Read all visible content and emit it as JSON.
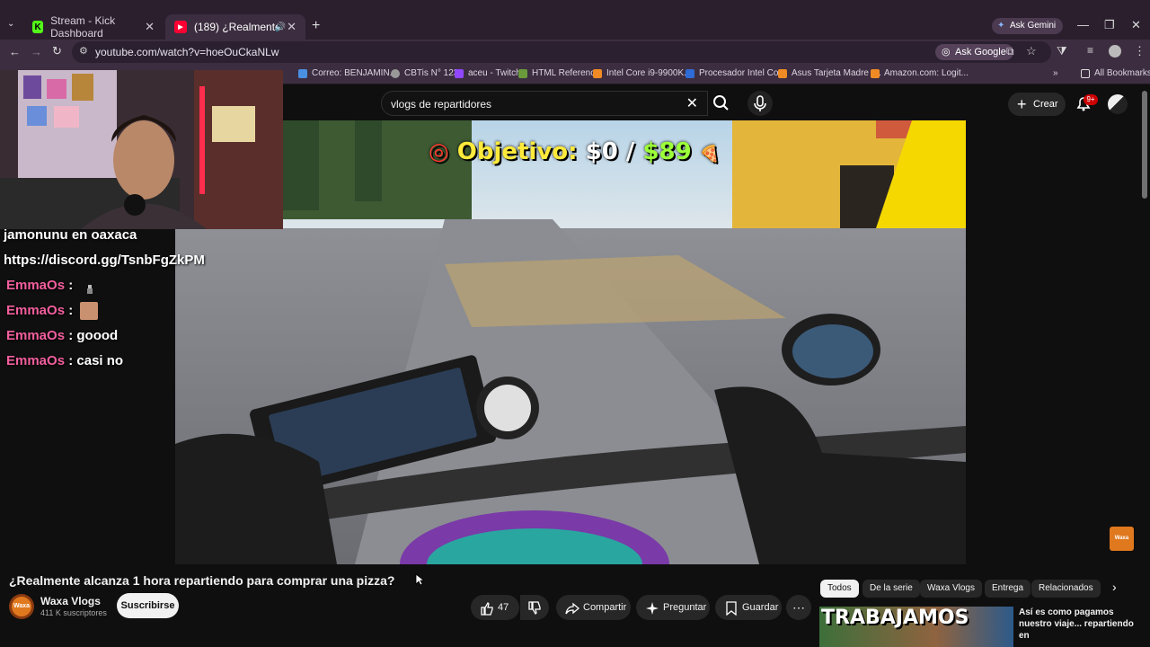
{
  "browser": {
    "tabs": [
      {
        "title": "Stream - Kick Dashboard",
        "favicon": "kick-icon"
      },
      {
        "title": "(189) ¿Realmente alcanza 1",
        "favicon": "youtube-icon"
      }
    ],
    "ask_gemini": "Ask Gemini",
    "url": "youtube.com/watch?v=hoeOuCkaNLw",
    "ask_google": "Ask Google",
    "bookmarks": [
      "Correo: BENJAMIN...",
      "CBTis N° 123",
      "aceu - Twitch",
      "HTML Reference",
      "Intel Core i9-9900K...",
      "Procesador Intel Co...",
      "Asus Tarjeta Madre I...",
      "Amazon.com: Logit..."
    ],
    "all_bookmarks": "All Bookmarks",
    "chevron": "»"
  },
  "youtube": {
    "search_query": "vlogs de repartidores",
    "create_label": "Crear",
    "notif_count": "9+"
  },
  "video": {
    "overlay_goal_label": "Objetivo:",
    "overlay_current": "$0",
    "overlay_sep": "/",
    "overlay_target": "$89",
    "chat_lines": [
      {
        "text": "jamonunu en oaxaca"
      },
      {
        "text": "https://discord.gg/TsnbFgZkPM"
      },
      {
        "user": "EmmaOs",
        "msg": ":"
      },
      {
        "user": "EmmaOs",
        "msg": ":"
      },
      {
        "user": "EmmaOs",
        "msg": ": goood"
      },
      {
        "user": "EmmaOs",
        "msg": ": casi no"
      }
    ]
  },
  "watch": {
    "title": "¿Realmente alcanza 1 hora repartiendo para comprar una pizza?",
    "channel": "Waxa Vlogs",
    "channel_avatar_text": "Waxa",
    "subscribers": "411 K suscriptores",
    "subscribe": "Suscribirse",
    "likes": "47",
    "share": "Compartir",
    "ask": "Preguntar",
    "save": "Guardar"
  },
  "related": {
    "chips": [
      "Todos",
      "De la serie",
      "Waxa Vlogs",
      "Entrega",
      "Relacionados"
    ],
    "thumb_text": "TRABAJAMOS",
    "title": "Así es como pagamos nuestro viaje... repartiendo en"
  },
  "colors": {
    "chat_user": "#f35f9e",
    "overlay_goal": "#ffea3c",
    "overlay_target": "#9cff3a",
    "browser_frame": "#3c2e40"
  }
}
